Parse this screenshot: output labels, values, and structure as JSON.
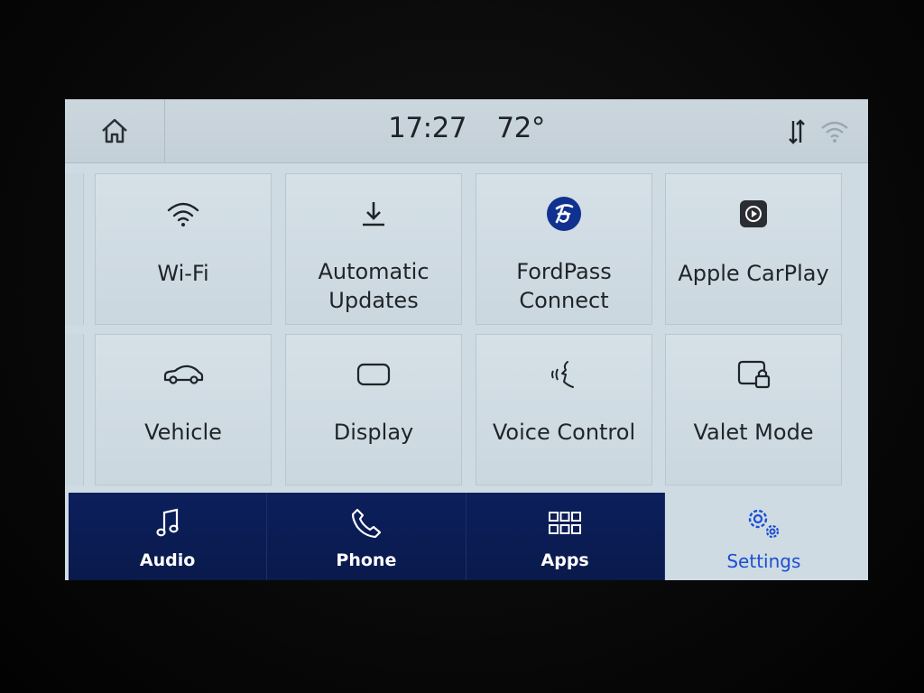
{
  "status_bar": {
    "time": "17:27",
    "temperature": "72°",
    "icons": [
      "home-icon",
      "data-transfer-icon",
      "wifi-signal-icon"
    ]
  },
  "tiles": [
    {
      "label": "Wi-Fi",
      "icon": "wifi-icon"
    },
    {
      "label": "Automatic Updates",
      "line1": "Automatic",
      "line2": "Updates",
      "icon": "download-icon"
    },
    {
      "label": "FordPass Connect",
      "line1": "FordPass",
      "line2": "Connect",
      "icon": "fordpass-logo-icon"
    },
    {
      "label": "Apple CarPlay",
      "icon": "carplay-icon"
    },
    {
      "label": "Vehicle",
      "icon": "car-icon"
    },
    {
      "label": "Display",
      "icon": "display-icon"
    },
    {
      "label": "Voice Control",
      "icon": "voice-icon"
    },
    {
      "label": "Valet Mode",
      "icon": "valet-lock-icon"
    }
  ],
  "pagination": {
    "pages": 2,
    "current": 2
  },
  "nav": [
    {
      "label": "Audio",
      "icon": "music-note-icon",
      "active": false
    },
    {
      "label": "Phone",
      "icon": "phone-icon",
      "active": false
    },
    {
      "label": "Apps",
      "icon": "apps-grid-icon",
      "active": false
    },
    {
      "label": "Settings",
      "icon": "gears-icon",
      "active": true
    }
  ],
  "colors": {
    "screen_bg": "#cfdbe3",
    "nav_bg": "#0c1f5c",
    "accent": "#1c4fd0",
    "text": "#1f2428"
  }
}
